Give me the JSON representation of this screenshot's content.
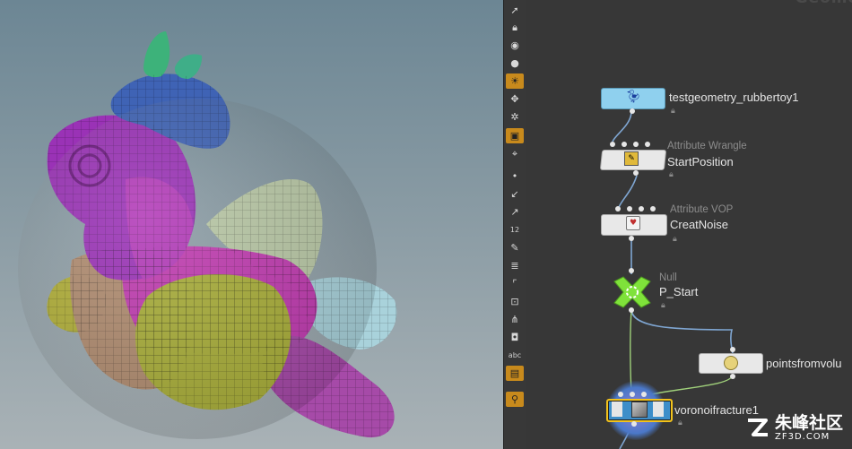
{
  "network": {
    "context_title": "Geome",
    "nodes": [
      {
        "id": "testgeometry",
        "type_label": "",
        "name": "testgeometry_rubbertoy1",
        "icon": "rubbertoy-icon",
        "color": "#8fd0ee"
      },
      {
        "id": "startposition",
        "type_label": "Attribute Wrangle",
        "name": "StartPosition",
        "icon": "wrangle-icon",
        "color": "#e8e8e8"
      },
      {
        "id": "creatnoise",
        "type_label": "Attribute VOP",
        "name": "CreatNoise",
        "icon": "vop-icon",
        "color": "#e8e8e8"
      },
      {
        "id": "p_start",
        "type_label": "Null",
        "name": "P_Start",
        "icon": "null-icon",
        "color": "#7fe23a"
      },
      {
        "id": "pointsfromvolume",
        "type_label": "",
        "name": "pointsfromvolu",
        "icon": "points-icon",
        "color": "#e8e8e8"
      },
      {
        "id": "voronoifracture",
        "type_label": "",
        "name": "voronoifracture1",
        "icon": "voronoi-icon",
        "color": "#4a78c8"
      }
    ]
  },
  "toolbar": {
    "tools": [
      "select-icon",
      "lock-icon",
      "view-icon",
      "sphere-icon",
      "light-icon",
      "pin-icon",
      "snapshot-icon",
      "display-icon",
      "camera-icon",
      "point-icon",
      "brush-icon",
      "wand-icon",
      "numbers-icon",
      "paint-icon",
      "stack-icon",
      "corner-icon",
      "bounds-icon",
      "branch-icon",
      "shade-icon",
      "text-label-icon",
      "image-icon",
      "marker-icon"
    ],
    "text_label": "abc",
    "numbers_label": "12"
  },
  "watermark": {
    "text": "朱峰社区",
    "sub": "ZF3D.COM"
  }
}
